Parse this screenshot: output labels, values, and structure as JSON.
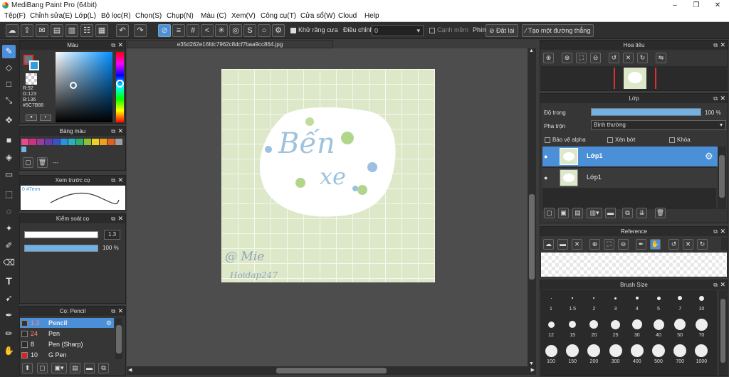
{
  "window": {
    "title": "MediBang Paint Pro (64bit)",
    "controls": [
      "‒",
      "❐",
      "✕"
    ]
  },
  "menu": [
    "Tệp(F)",
    "Chỉnh sửa(E)",
    "Lớp(L)",
    "Bộ lọc(R)",
    "Chọn(S)",
    "Chụp(N)",
    "Màu (C)",
    "Xem(V)",
    "Công cụ(T)",
    "Cửa sổ(W)",
    "Cloud",
    "Help"
  ],
  "toolbar": {
    "antialias_label": "Khử răng cưa",
    "adjust_label": "Điều chỉnh",
    "adjust_value": "0",
    "edge_label": "Cạnh mềm",
    "key_label": "Phím",
    "reset_label": "Đặt lại",
    "line_label": "Tạo một đường thẳng"
  },
  "color_panel": {
    "title": "Màu",
    "r": "R:92",
    "g": "G:123",
    "b": "B:136",
    "hex": "#5C7B88",
    "main_color": "#5c7b88",
    "accent": "#4a8fd8"
  },
  "palette_panel": {
    "title": "Bảng màu",
    "colors": [
      "#e84a8a",
      "#d03080",
      "#9a3a9a",
      "#6a3ab0",
      "#3a50c8",
      "#2a90e0",
      "#2ab0c0",
      "#2ab070",
      "#90c030",
      "#f0d020",
      "#f0a020",
      "#e06020",
      "#a0a0a0"
    ],
    "name_placeholder": "---"
  },
  "brush_preview_panel": {
    "title": "Xem trước cọ",
    "size": "0.47mm"
  },
  "brush_control_panel": {
    "title": "Kiểm soát cọ",
    "size_value": "1.3",
    "opacity_value": "100 %"
  },
  "brush_list_panel": {
    "title": "Cọ: Pencil",
    "items": [
      {
        "size": "1.3",
        "name": "Pencil",
        "color": "#333333"
      },
      {
        "size": "24",
        "name": "Pen",
        "color": "#2a2a2a"
      },
      {
        "size": "8",
        "name": "Pen (Sharp)",
        "color": "#2a2a2a"
      },
      {
        "size": "10",
        "name": "G Pen",
        "color": "#e02020"
      }
    ]
  },
  "document": {
    "filename": "e35d262e16fdc7962c8dcf7baa9cc864.jpg"
  },
  "artwork": {
    "title_line1": "Bến",
    "title_line2": "xe",
    "signature": "@ Mie",
    "watermark": "Hoidap247"
  },
  "navigator_panel": {
    "title": "Hoa tiêu"
  },
  "layer_panel": {
    "title": "Lớp",
    "opacity_label": "Độ trong",
    "opacity_value": "100 %",
    "opacity_fraction": 1.0,
    "blend_label": "Pha trộn",
    "blend_value": "Bình thường",
    "protect_alpha": "Bảo vệ alpha",
    "clipping": "Xén bớt",
    "lock": "Khóa",
    "layers": [
      {
        "name": "Lớp1",
        "selected": true
      },
      {
        "name": "Lớp1",
        "selected": false
      }
    ]
  },
  "reference_panel": {
    "title": "Reference"
  },
  "brush_size_panel": {
    "title": "Brush Size",
    "sizes": [
      "1",
      "1.5",
      "2",
      "3",
      "4",
      "5",
      "7",
      "10",
      "12",
      "15",
      "20",
      "25",
      "30",
      "40",
      "50",
      "70",
      "100",
      "150",
      "200",
      "300",
      "400",
      "500",
      "700",
      "1000"
    ]
  }
}
